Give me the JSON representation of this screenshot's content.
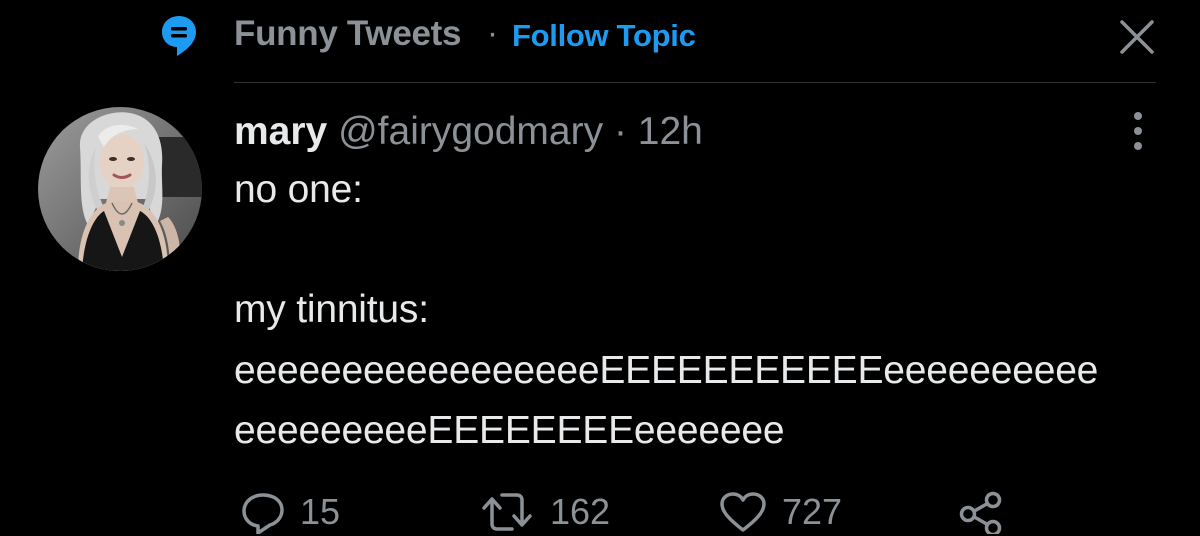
{
  "topic": {
    "icon": "topic-speech-bubble-icon",
    "name": "Funny Tweets",
    "separator": "·",
    "follow_label": "Follow Topic",
    "close_icon": "close-icon"
  },
  "tweet": {
    "avatar": "avatar",
    "author_name": "mary",
    "author_handle": "@fairygodmary",
    "separator": "·",
    "time": "12h",
    "more_icon": "more-vertical-icon",
    "lines": [
      "no one:",
      "my tinnitus:",
      "eeeeeeeeeeeeeeeeeEEEEEEEEEEEeeeeeeeeee",
      "eeeeeeeeeEEEEEEEEeeeeeee"
    ]
  },
  "actions": {
    "reply": {
      "icon": "reply-icon",
      "count": "15"
    },
    "retweet": {
      "icon": "retweet-icon",
      "count": "162"
    },
    "like": {
      "icon": "heart-icon",
      "count": "727"
    },
    "share": {
      "icon": "share-icon"
    }
  },
  "colors": {
    "background": "#000000",
    "accent": "#1d9bf0",
    "primary_text": "#e7e9ea",
    "secondary_text": "#8b9196",
    "divider": "#2f3336"
  }
}
